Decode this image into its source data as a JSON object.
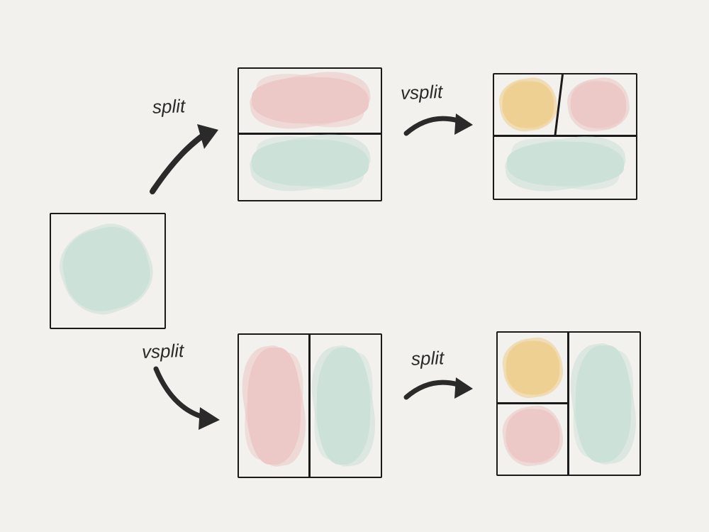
{
  "diagram": {
    "labels": {
      "top_first": "split",
      "top_second": "vsplit",
      "bot_first": "vsplit",
      "bot_second": "split"
    },
    "nodes": {
      "start": {
        "desc": "single pane",
        "panes": [
          {
            "color": "green"
          }
        ]
      },
      "top_mid": {
        "desc": "horizontal split (two rows)",
        "split": "horizontal",
        "panes": [
          {
            "color": "pink"
          },
          {
            "color": "green"
          }
        ]
      },
      "top_end": {
        "desc": "top row vertically split; bottom intact",
        "top_row": [
          {
            "color": "yellow"
          },
          {
            "color": "pink"
          }
        ],
        "bottom_row": [
          {
            "color": "green"
          }
        ]
      },
      "bot_mid": {
        "desc": "vertical split (two columns)",
        "split": "vertical",
        "panes": [
          {
            "color": "pink"
          },
          {
            "color": "green"
          }
        ]
      },
      "bot_end": {
        "desc": "left column horizontally split; right intact",
        "left_col": [
          {
            "color": "yellow"
          },
          {
            "color": "pink"
          }
        ],
        "right_col": [
          {
            "color": "green"
          }
        ]
      }
    },
    "flow": [
      {
        "from": "start",
        "to": "top_mid",
        "op": "split"
      },
      {
        "from": "top_mid",
        "to": "top_end",
        "op": "vsplit"
      },
      {
        "from": "start",
        "to": "bot_mid",
        "op": "vsplit"
      },
      {
        "from": "bot_mid",
        "to": "bot_end",
        "op": "split"
      }
    ]
  }
}
